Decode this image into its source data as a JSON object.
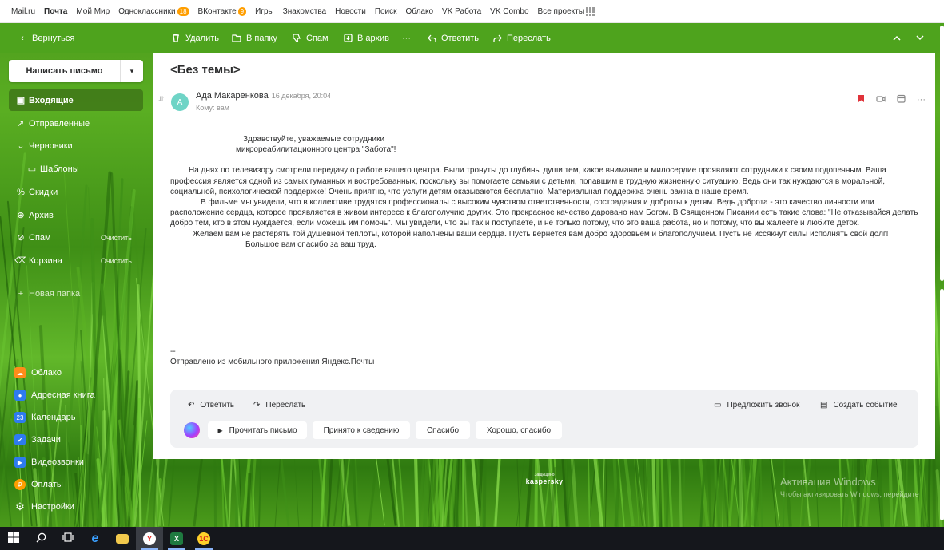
{
  "portal": {
    "links": [
      "Mail.ru",
      "Почта",
      "Мой Мир",
      "Одноклассники",
      "ВКонтакте",
      "Игры",
      "Знакомства",
      "Новости",
      "Поиск",
      "Облако",
      "VK Работа",
      "VK Combo",
      "Все проекты"
    ],
    "ok_badge": "18",
    "vk_badge": "9"
  },
  "toolbar": {
    "back": "Вернуться",
    "delete": "Удалить",
    "to_folder": "В папку",
    "spam": "Спам",
    "archive": "В архив",
    "more": "···",
    "reply": "Ответить",
    "forward": "Переслать"
  },
  "sidebar": {
    "compose": "Написать письмо",
    "folders": [
      {
        "label": "Входящие"
      },
      {
        "label": "Отправленные"
      },
      {
        "label": "Черновики"
      },
      {
        "label": "Шаблоны"
      },
      {
        "label": "Скидки"
      },
      {
        "label": "Архив"
      },
      {
        "label": "Спам",
        "action": "Очистить"
      },
      {
        "label": "Корзина",
        "action": "Очистить"
      }
    ],
    "new_folder": "Новая папка",
    "apps": [
      "Облако",
      "Адресная книга",
      "Календарь",
      "Задачи",
      "Видеозвонки",
      "Оплаты",
      "Настройки"
    ]
  },
  "letter": {
    "subject": "<Без темы>",
    "avatar_letter": "А",
    "sender": "Ада Макаренкова",
    "date": "16 декабря, 20:04",
    "to": "Кому:  вам",
    "greeting_1": "Здравствуйте, уважаемые сотрудники",
    "greeting_2": "микрореабилитационного центра \"Забота\"!",
    "para_1": "На днях по телевизору смотрели передачу о работе вашего центра. Были тронуты до глубины души тем, какое внимание и милосердие проявляют сотрудники к своим подопечным. Ваша профессия является одной из самых гуманных и востребованных, поскольку вы помогаете семьям с детьми, попавшим в трудную жизненную ситуацию. Ведь они так нуждаются в моральной, социальной, психологической поддержке! Очень приятно, что услуги детям оказываются бесплатно! Материальная поддержка очень важна в наше время.",
    "para_2": "В фильме мы увидели, что в коллективе трудятся профессионалы с высоким чувством ответственности, сострадания и доброты к детям. Ведь доброта - это качество личности или расположение сердца, которое проявляется в живом интересе к благополучию других. Это прекрасное качество даровано нам Богом. В Священном Писании есть такие слова: \"Не отказывайся делать добро тем, кто в этом нуждается, если можешь им помочь\". Мы увидели, что вы так и поступаете, и не только потому, что это ваша работа, но и потому, что вы жалеете и любите деток.",
    "para_3": "Желаем вам не растерять той душевной теплоты, которой наполнены ваши сердца. Пусть вернётся вам добро здоровьем и благополучием. Пусть не иссякнут силы исполнять свой долг!",
    "para_4": "Большое вам спасибо за ваш труд.",
    "sig_dash": "--",
    "signature": "Отправлено из мобильного приложения Яндекс.Почты"
  },
  "reply_box": {
    "reply": "Ответить",
    "forward": "Переслать",
    "call": "Предложить звонок",
    "event": "Создать событие",
    "read_aloud": "Прочитать письмо",
    "quick": [
      "Принято к сведению",
      "Спасибо",
      "Хорошо, спасибо"
    ]
  },
  "kaspersky": {
    "line1": "Защищено",
    "line2": "kaspersky"
  },
  "activation": {
    "line1": "Активация Windows",
    "line2": "Чтобы активировать Windows, перейдите"
  },
  "colors": {
    "toolbar_green": "#4ea31d",
    "flag_red": "#e0333a",
    "badge_orange": "#ff9e00"
  }
}
